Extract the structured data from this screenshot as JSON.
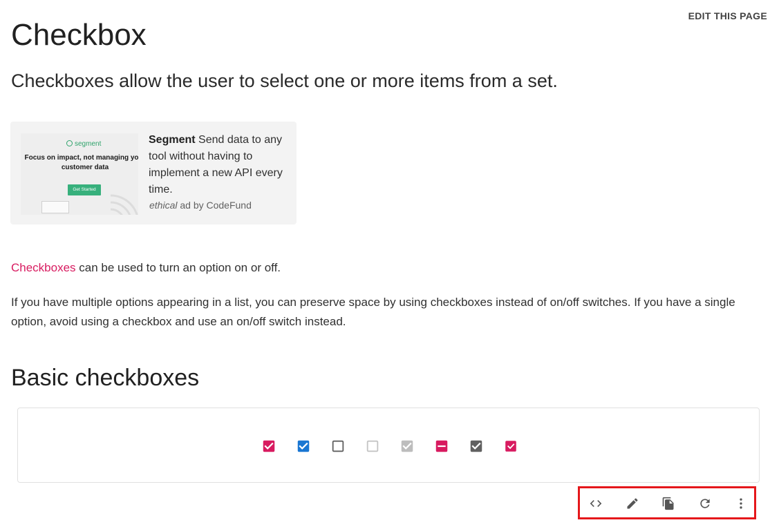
{
  "header": {
    "edit_label": "EDIT THIS PAGE"
  },
  "page": {
    "title": "Checkbox",
    "subtitle": "Checkboxes allow the user to select one or more items from a set."
  },
  "ad": {
    "image": {
      "brand": "segment",
      "headline": "Focus on impact, not managing your customer data",
      "cta": "Get Started"
    },
    "sponsor": "Segment",
    "text": " Send data to any tool without having to implement a new API every time.",
    "credit_ethical": "ethical",
    "credit_rest": " ad by CodeFund"
  },
  "intro": {
    "link": "Checkboxes",
    "text": " can be used to turn an option on or off.",
    "paragraph": "If you have multiple options appearing in a list, you can preserve space by using checkboxes instead of on/off switches. If you have a single option, avoid using a checkbox and use an on/off switch instead."
  },
  "section": {
    "title": "Basic checkboxes"
  },
  "checkboxes": [
    {
      "state": "checked",
      "color": "#d81b60"
    },
    {
      "state": "checked",
      "color": "#1976d2"
    },
    {
      "state": "unchecked",
      "color": "#616161"
    },
    {
      "state": "unchecked-disabled",
      "color": "#c4c4c4"
    },
    {
      "state": "checked-disabled",
      "color": "#bdbdbd"
    },
    {
      "state": "indeterminate",
      "color": "#d81b60"
    },
    {
      "state": "checked",
      "color": "#616161"
    },
    {
      "state": "checked-small",
      "color": "#d81b60"
    }
  ],
  "toolbar": {
    "icons": [
      "code-icon",
      "edit-icon",
      "copy-icon",
      "reset-icon",
      "more-vert-icon"
    ],
    "highlight_color": "#e5171b"
  }
}
